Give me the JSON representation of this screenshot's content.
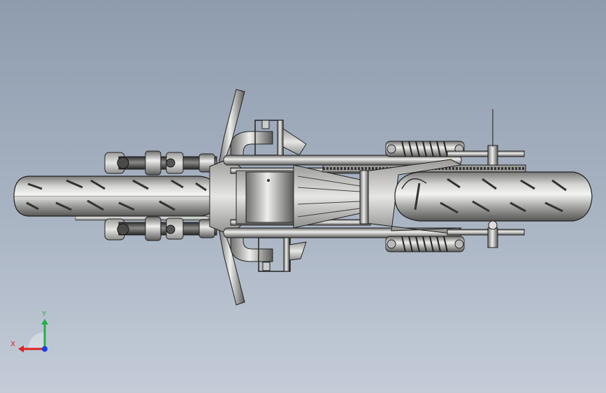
{
  "viewport": {
    "model": "motorcycle-assembly",
    "view": "top"
  },
  "triad": {
    "x_label": "X",
    "y_label": "Y",
    "colors": {
      "x": "#e02020",
      "y": "#22b04a",
      "z": "#1a3ee0"
    }
  }
}
